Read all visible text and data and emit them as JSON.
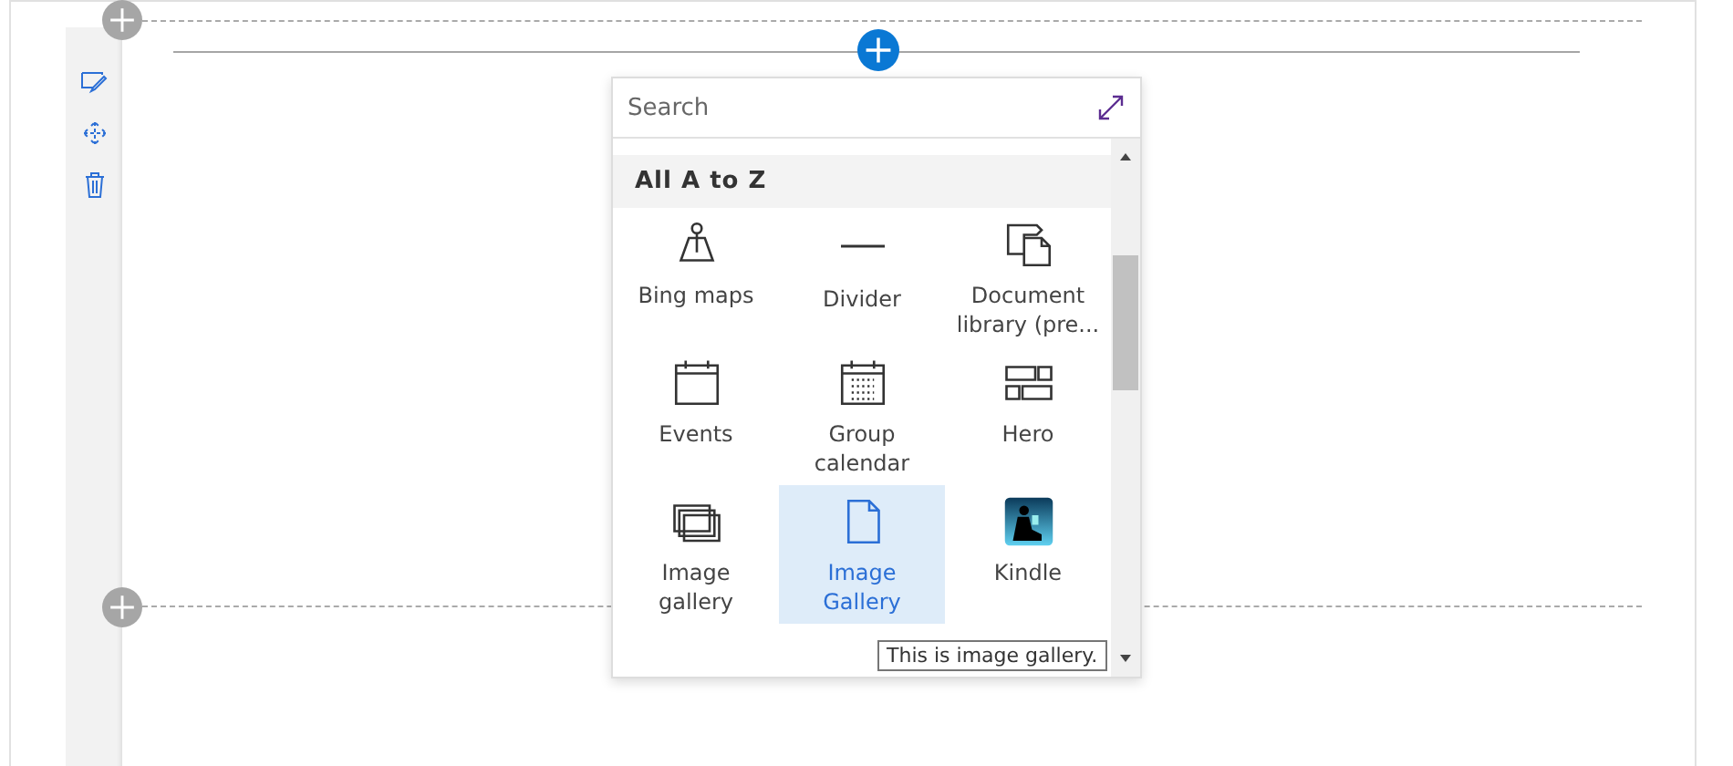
{
  "toolbox": {
    "search": {
      "placeholder": "Search"
    },
    "section_title": "All A to Z",
    "items": [
      {
        "kind": "map",
        "label": "Bing maps",
        "selected": false
      },
      {
        "kind": "divider",
        "label": "Divider",
        "selected": false
      },
      {
        "kind": "doclib",
        "label": "Document library (pre...",
        "selected": false
      },
      {
        "kind": "events",
        "label": "Events",
        "selected": false
      },
      {
        "kind": "calendar",
        "label": "Group calendar",
        "selected": false
      },
      {
        "kind": "hero",
        "label": "Hero",
        "selected": false
      },
      {
        "kind": "gallery",
        "label": "Image gallery",
        "selected": false
      },
      {
        "kind": "page",
        "label": "Image Gallery",
        "selected": true
      },
      {
        "kind": "picture",
        "label": "Kindle",
        "selected": false
      }
    ],
    "tooltip": "This is image gallery."
  }
}
